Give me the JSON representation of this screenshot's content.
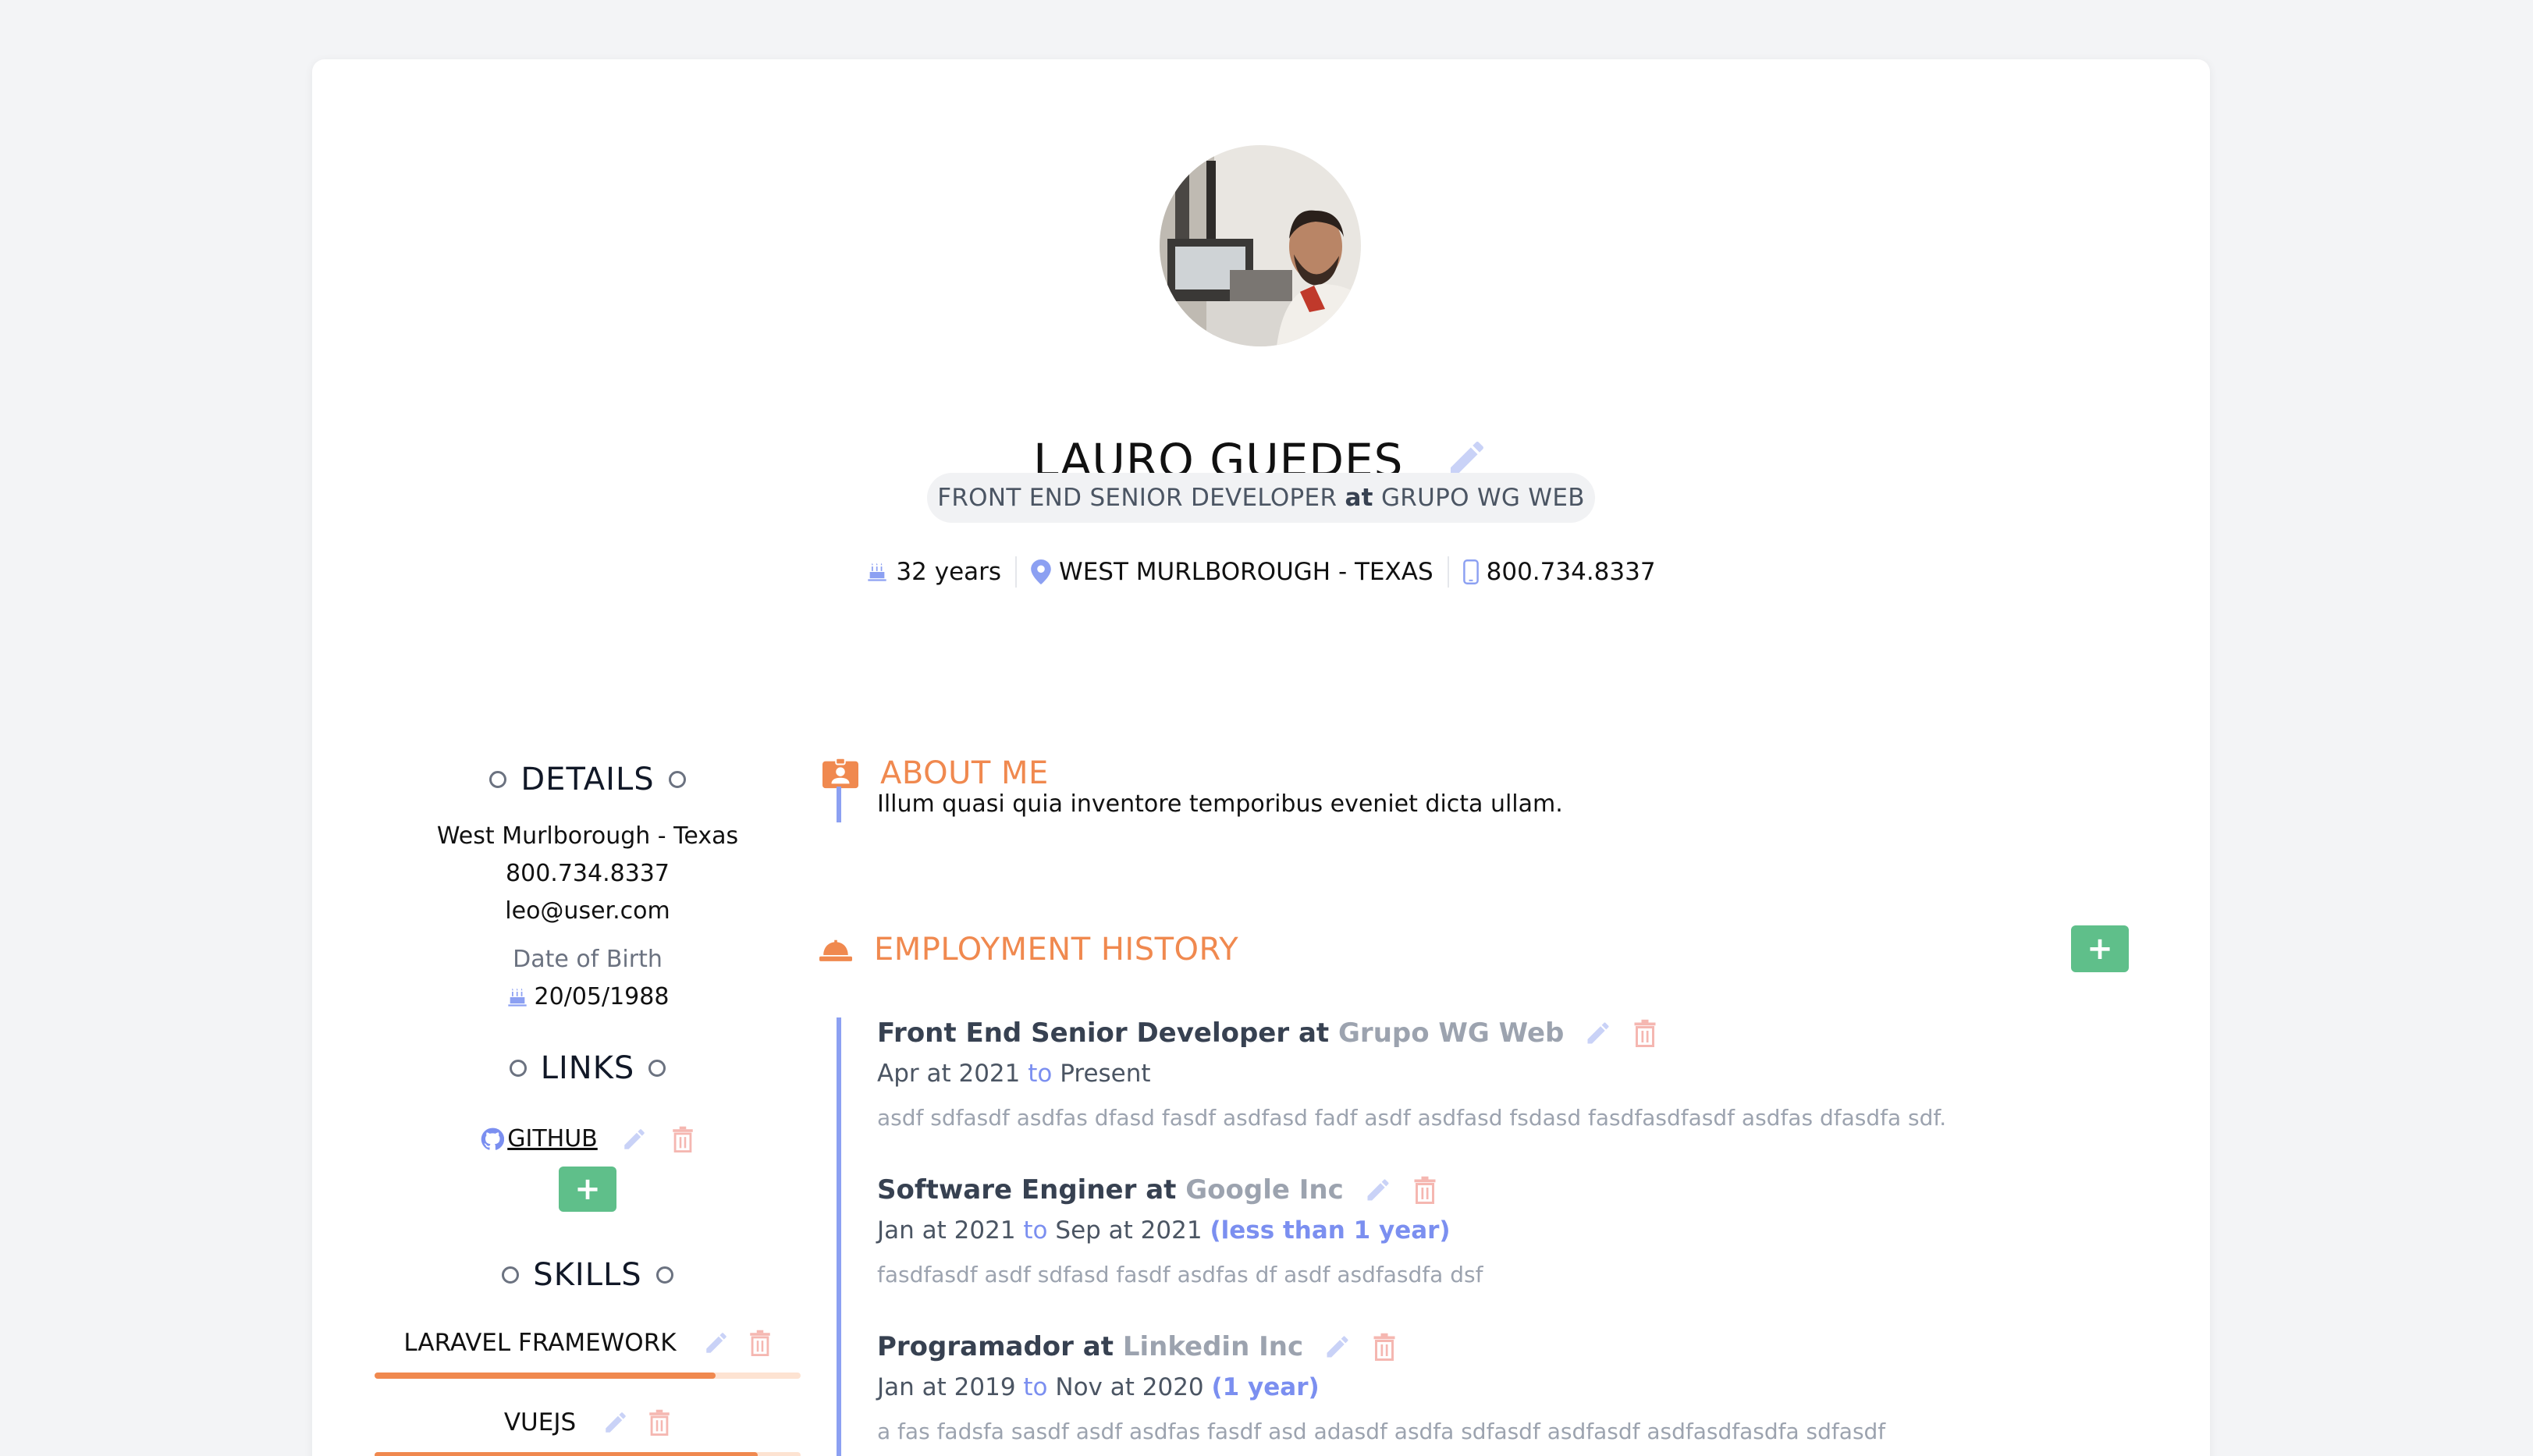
{
  "profile": {
    "name": "LAURO GUEDES",
    "title": "FRONT END SENIOR DEVELOPER",
    "at_word": "at",
    "company": "GRUPO WG WEB",
    "age": "32 years",
    "location": "WEST MURLBOROUGH - TEXAS",
    "phone": "800.734.8337"
  },
  "details": {
    "heading": "DETAILS",
    "location": "West Murlborough - Texas",
    "phone": "800.734.8337",
    "email": "leo@user.com",
    "dob_label": "Date of Birth",
    "dob": "20/05/1988"
  },
  "links": {
    "heading": "LINKS",
    "items": [
      {
        "label": " GITHUB",
        "icon": "github-icon"
      }
    ],
    "add_label": "+"
  },
  "skills": {
    "heading": "SKILLS",
    "items": [
      {
        "label": "LARAVEL FRAMEWORK",
        "level": 0.8
      },
      {
        "label": "VUEJS",
        "level": 0.9
      }
    ]
  },
  "about": {
    "heading": "ABOUT ME",
    "text": "Illum quasi quia inventore temporibus eveniet dicta ullam."
  },
  "employment": {
    "heading": "EMPLOYMENT HISTORY",
    "add_label": "+",
    "to_word": "to",
    "jobs": [
      {
        "role": "Front End Senior Developer at",
        "company": "Grupo WG Web",
        "start": "Apr at 2021",
        "end": "Present",
        "duration": "",
        "description": "asdf sdfasdf asdfas dfasd fasdf asdfasd fadf asdf asdfasd fsdasd fasdfasdfasdf asdfas dfasdfa sdf."
      },
      {
        "role": "Software Enginer at",
        "company": "Google Inc",
        "start": "Jan at 2021",
        "end": "Sep at 2021",
        "duration": "(less than 1 year)",
        "description": "fasdfasdf asdf sdfasd fasdf asdfas df asdf asdfasdfa dsf"
      },
      {
        "role": "Programador at",
        "company": "Linkedin Inc",
        "start": "Jan at 2019",
        "end": "Nov at 2020",
        "duration": "(1 year)",
        "description": "a fas fadsfa sasdf asdf asdfas fasdf asd adasdf asdfa sdfasdf asdfasdf asdfasdfasdfa sdfasdf"
      }
    ]
  },
  "colors": {
    "accent_orange": "#f0894f",
    "accent_blue": "#8ca0f2",
    "add_green": "#5fbf8a",
    "delete_red": "#f5b7b1"
  }
}
